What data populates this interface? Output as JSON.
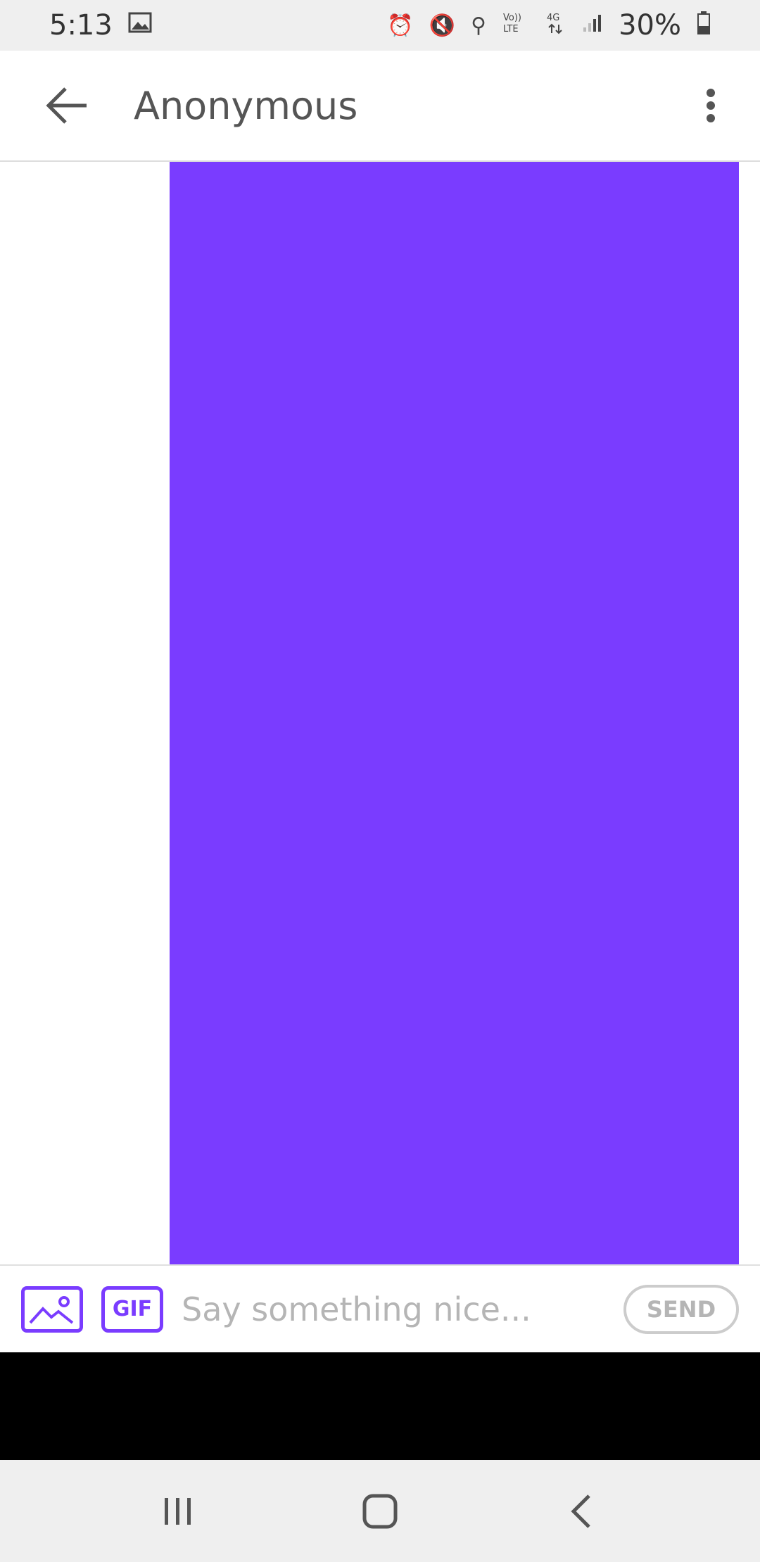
{
  "status_bar": {
    "time": "5:13",
    "battery": "30%",
    "icons": [
      "image-icon",
      "alarm-icon",
      "vibrate-icon",
      "location-icon",
      "volte-icon",
      "4g-icon",
      "signal-icon",
      "battery-icon"
    ]
  },
  "header": {
    "title": "Anonymous",
    "icons": [
      "back-arrow-icon",
      "more-options-icon"
    ]
  },
  "message": {
    "text": ""
  },
  "composer": {
    "gif_label": "GIF",
    "placeholder": "Say something nice...",
    "send_label": "SEND"
  },
  "colors": {
    "accent": "#7a3cff",
    "status_bar_bg": "#efefef",
    "placeholder": "#b5b5b5"
  }
}
